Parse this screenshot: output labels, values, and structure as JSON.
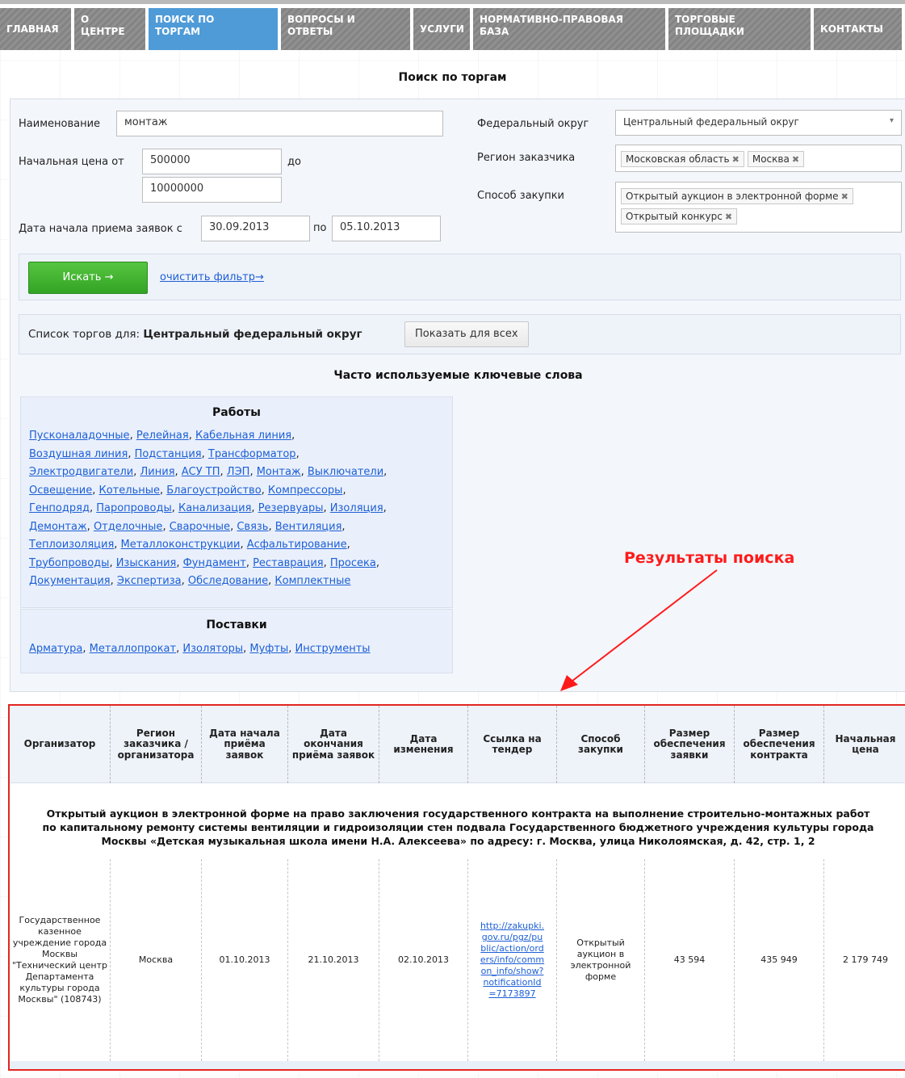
{
  "nav": {
    "items": [
      {
        "label": "ГЛАВНАЯ"
      },
      {
        "label": "О\nЦЕНТРЕ"
      },
      {
        "label": "ПОИСК ПО\nТОРГАМ"
      },
      {
        "label": "ВОПРОСЫ И\nОТВЕТЫ"
      },
      {
        "label": "УСЛУГИ"
      },
      {
        "label": "НОРМАТИВНО-ПРАВОВАЯ\nБАЗА"
      },
      {
        "label": "ТОРГОВЫЕ\nПЛОЩАДКИ"
      },
      {
        "label": "КОНТАКТЫ"
      }
    ],
    "active_index": 2
  },
  "page_title": "Поиск по торгам",
  "form": {
    "name_label": "Наименование",
    "name_value": "монтаж",
    "price_from_label": "Начальная цена от",
    "price_from_value": "500000",
    "price_to_label": "до",
    "price_to_value": "10000000",
    "date_label": "Дата начала приема заявок с",
    "date_from_value": "30.09.2013",
    "date_to_label": "по",
    "date_to_value": "05.10.2013",
    "district_label": "Федеральный округ",
    "district_value": "Центральный федеральный округ",
    "region_label": "Регион заказчика",
    "region_tags": [
      "Московская область",
      "Москва"
    ],
    "method_label": "Способ закупки",
    "method_tags": [
      "Открытый аукцион в электронной форме",
      "Открытый конкурс"
    ],
    "search_button": "Искать →",
    "clear_link": "очистить фильтр→"
  },
  "list_for": {
    "prefix": "Список торгов для:",
    "district": "Центральный федеральный округ",
    "show_all_button": "Показать для всех"
  },
  "keywords": {
    "title": "Часто используемые ключевые слова",
    "works": {
      "title": "Работы",
      "lines": [
        [
          "Пусконаладочные",
          "Релейная",
          "Кабельная линия"
        ],
        [
          "Воздушная линия",
          "Подстанция",
          "Трансформатор"
        ],
        [
          "Электродвигатели",
          "Линия",
          "АСУ ТП",
          "ЛЭП",
          "Монтаж",
          "Выключатели"
        ],
        [
          "Освещение",
          "Котельные",
          "Благоустройство",
          "Компрессоры"
        ],
        [
          "Генподряд",
          "Паропроводы",
          "Канализация",
          "Резервуары",
          "Изоляция"
        ],
        [
          "Демонтаж",
          "Отделочные",
          "Сварочные",
          "Связь",
          "Вентиляция"
        ],
        [
          "Теплоизоляция",
          "Металлоконструкции",
          "Асфальтирование"
        ],
        [
          "Трубопроводы",
          "Изыскания",
          "Фундамент",
          "Реставрация",
          "Просека"
        ],
        [
          "Документация",
          "Экспертиза",
          "Обследование",
          "Комплектные"
        ]
      ]
    },
    "supplies": {
      "title": "Поставки",
      "lines": [
        [
          "Арматура",
          "Металлопрокат",
          "Изоляторы",
          "Муфты",
          "Инструменты"
        ]
      ]
    }
  },
  "annotation": {
    "text": "Результаты поиска",
    "color": "#ff1a1a"
  },
  "results": {
    "columns": [
      "Организатор",
      "Регион заказчика / организатора",
      "Дата начала приёма заявок",
      "Дата окончания приёма заявок",
      "Дата изменения",
      "Ссылка на тендер",
      "Способ закупки",
      "Размер обеспечения заявки",
      "Размер обеспечения контракта",
      "Начальная цена"
    ],
    "description": "Открытый аукцион в электронной форме на право заключения государственного контракта на выполнение строительно-монтажных работ\nпо капитальному ремонту системы вентиляции и гидроизоляции стен подвала Государственного бюджетного учреждения культуры города\nМосквы «Детская музыкальная школа имени Н.А. Алексеева» по адресу: г. Москва, улица Николоямская, д. 42, стр. 1, 2",
    "row": {
      "organizer": "Государственное казенное учреждение города Москвы \"Технический центр Департамента культуры города Москвы\" (108743)",
      "region": "Москва",
      "date_start": "01.10.2013",
      "date_end": "21.10.2013",
      "date_changed": "02.10.2013",
      "link": "http://zakupki.gov.ru/pgz/public/action/orders/info/common_info/show?notificationId=7173897",
      "method": "Открытый аукцион в электронной форме",
      "bid_security": "43 594",
      "contract_security": "435 949",
      "start_price": "2 179 749"
    }
  },
  "colors": {
    "nav": "#878787",
    "nav_active": "#4e9bd8",
    "button_green": "#3db02d",
    "link": "#1c5fd6",
    "results_border": "#e3251f"
  }
}
